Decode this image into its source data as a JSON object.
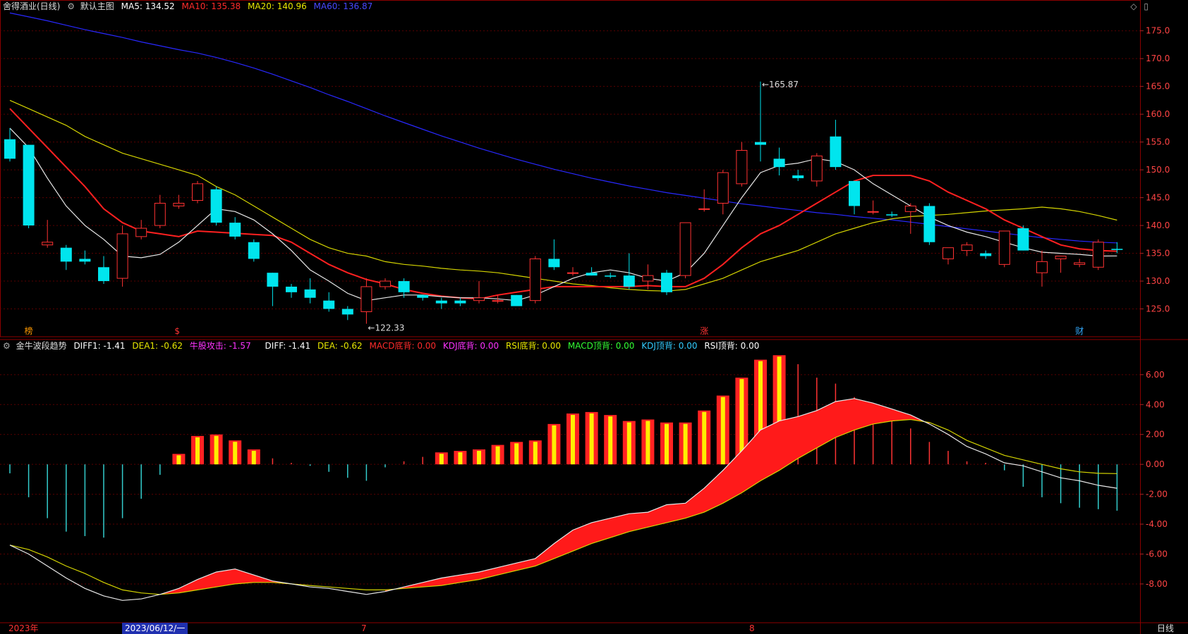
{
  "stock": {
    "title": "舍得酒业(日线)",
    "template": "默认主图",
    "ma_items": [
      {
        "label": "MA5: 134.52",
        "color": "#ffffff"
      },
      {
        "label": "MA10: 135.38",
        "color": "#ff2b2b"
      },
      {
        "label": "MA20: 140.96",
        "color": "#e8e800"
      },
      {
        "label": "MA60: 136.87",
        "color": "#2828ff"
      }
    ]
  },
  "indicator": {
    "name": "金牛波段趋势",
    "items": [
      {
        "label": "DIFF1: -1.41",
        "color": "#ffffff"
      },
      {
        "label": "DEA1: -0.62",
        "color": "#e8e800"
      },
      {
        "label": "牛股攻击: -1.57",
        "color": "#ff33ff"
      },
      {
        "label": "DIFF: -1.41",
        "color": "#ffffff"
      },
      {
        "label": "DEA: -0.62",
        "color": "#e8e800"
      },
      {
        "label": "MACD底背: 0.00",
        "color": "#ff2b2b"
      },
      {
        "label": "KDJ底背: 0.00",
        "color": "#ff33ff"
      },
      {
        "label": "RSI底背: 0.00",
        "color": "#e8e800"
      },
      {
        "label": "MACD顶背: 0.00",
        "color": "#33ff33"
      },
      {
        "label": "KDJ顶背: 0.00",
        "color": "#33ccff"
      },
      {
        "label": "RSI顶背: 0.00",
        "color": "#ffffff"
      }
    ]
  },
  "price_axis_labels": [
    "175.0",
    "170.0",
    "165.0",
    "160.0",
    "155.0",
    "150.0",
    "145.0",
    "140.0",
    "135.0",
    "130.0",
    "125.0"
  ],
  "macd_axis_labels": [
    "6.00",
    "4.00",
    "2.00",
    "0.00",
    "-2.00",
    "-4.00",
    "-6.00",
    "-8.00"
  ],
  "annotations": {
    "high": "165.87",
    "low": "122.33"
  },
  "markers": [
    "榜",
    "$",
    "涨",
    "财"
  ],
  "bottom": {
    "year": "2023年",
    "cursor_date": "2023/06/12/一",
    "jul": "7",
    "aug": "8",
    "period": "日线"
  },
  "icons": [
    "gear-icon",
    "diamond-icon",
    "window-icon"
  ],
  "chart_data": [
    {
      "type": "candlestick",
      "title": "舍得酒业(日线)",
      "ylim": [
        120,
        178
      ],
      "ohlc": [
        [
          155.5,
          157.5,
          151.5,
          152.0
        ],
        [
          154.5,
          154.5,
          139.5,
          140.0
        ],
        [
          136.5,
          141.0,
          136.0,
          137.0
        ],
        [
          136.0,
          136.5,
          132.0,
          133.5
        ],
        [
          134.0,
          135.5,
          133.0,
          133.5
        ],
        [
          132.5,
          134.5,
          129.5,
          130.0
        ],
        [
          130.5,
          140.0,
          129.0,
          138.5
        ],
        [
          138.0,
          141.0,
          137.5,
          139.5
        ],
        [
          140.0,
          145.5,
          139.5,
          144.0
        ],
        [
          143.5,
          145.5,
          143.0,
          144.0
        ],
        [
          144.5,
          148.0,
          144.0,
          147.5
        ],
        [
          146.5,
          147.0,
          140.0,
          140.5
        ],
        [
          140.5,
          141.5,
          137.5,
          138.0
        ],
        [
          137.0,
          137.5,
          133.5,
          134.0
        ],
        [
          131.5,
          131.5,
          125.5,
          129.0
        ],
        [
          129.0,
          129.5,
          127.0,
          128.0
        ],
        [
          128.5,
          130.5,
          126.0,
          127.0
        ],
        [
          126.5,
          128.0,
          124.5,
          125.0
        ],
        [
          125.0,
          125.5,
          123.0,
          124.0
        ],
        [
          124.5,
          130.5,
          122.33,
          129.0
        ],
        [
          129.0,
          130.5,
          128.5,
          130.0
        ],
        [
          130.0,
          130.5,
          127.0,
          128.0
        ],
        [
          127.5,
          127.5,
          126.5,
          127.0
        ],
        [
          126.5,
          127.0,
          125.0,
          126.0
        ],
        [
          126.5,
          127.0,
          125.5,
          126.0
        ],
        [
          126.5,
          130.0,
          126.0,
          127.0
        ],
        [
          126.5,
          127.5,
          126.0,
          126.5
        ],
        [
          127.5,
          127.5,
          126.0,
          125.5
        ],
        [
          126.5,
          134.5,
          126.0,
          134.0
        ],
        [
          134.0,
          137.5,
          132.0,
          132.5
        ],
        [
          131.5,
          132.5,
          131.0,
          131.5
        ],
        [
          131.5,
          132.5,
          131.0,
          131.0
        ],
        [
          131.0,
          131.5,
          130.5,
          130.8
        ],
        [
          131.0,
          135.0,
          128.5,
          129.0
        ],
        [
          130.0,
          133.0,
          128.5,
          131.0
        ],
        [
          131.5,
          132.0,
          127.5,
          128.0
        ],
        [
          131.0,
          140.5,
          130.5,
          140.5
        ],
        [
          143.0,
          146.5,
          142.5,
          143.0
        ],
        [
          144.0,
          150.0,
          142.0,
          149.5
        ],
        [
          147.5,
          155.0,
          147.0,
          153.5
        ],
        [
          155.0,
          165.87,
          151.5,
          154.5
        ],
        [
          152.0,
          154.0,
          149.0,
          150.5
        ],
        [
          149.0,
          150.0,
          148.0,
          148.5
        ],
        [
          148.0,
          153.0,
          147.0,
          152.5
        ],
        [
          156.0,
          159.0,
          150.0,
          150.5
        ],
        [
          148.0,
          148.0,
          142.0,
          143.5
        ],
        [
          142.5,
          144.5,
          142.0,
          142.5
        ],
        [
          142.0,
          142.5,
          141.5,
          141.8
        ],
        [
          142.5,
          144.0,
          138.5,
          143.5
        ],
        [
          143.5,
          144.0,
          136.5,
          137.0
        ],
        [
          134.0,
          136.0,
          133.0,
          136.0
        ],
        [
          135.5,
          137.0,
          134.5,
          136.5
        ],
        [
          135.0,
          135.5,
          134.0,
          134.5
        ],
        [
          133.0,
          139.0,
          132.5,
          139.0
        ],
        [
          139.5,
          140.0,
          135.5,
          135.5
        ],
        [
          131.5,
          135.5,
          129.0,
          133.5
        ],
        [
          134.0,
          134.5,
          131.5,
          134.5
        ],
        [
          133.0,
          134.0,
          132.5,
          133.3
        ],
        [
          132.5,
          137.5,
          132.0,
          137.0
        ],
        [
          135.8,
          137.0,
          135.0,
          135.6
        ]
      ],
      "ma5": [
        157.5,
        154.0,
        148.5,
        143.5,
        140.0,
        137.5,
        134.5,
        134.2,
        134.8,
        137.0,
        140.0,
        143.0,
        142.5,
        141.0,
        138.5,
        135.5,
        132.0,
        130.0,
        127.8,
        126.5,
        127.0,
        127.5,
        127.5,
        127.2,
        127.0,
        127.0,
        126.8,
        126.5,
        127.5,
        129.0,
        130.5,
        131.5,
        132.0,
        131.5,
        130.5,
        130.0,
        131.5,
        135.0,
        140.0,
        145.0,
        149.5,
        150.8,
        151.2,
        152.0,
        151.5,
        150.0,
        147.5,
        145.5,
        143.5,
        141.5,
        140.0,
        138.8,
        138.0,
        137.0,
        136.0,
        135.2,
        135.0,
        134.8,
        134.5,
        134.52
      ],
      "ma10": [
        161.0,
        157.5,
        154.0,
        150.5,
        147.0,
        143.0,
        140.5,
        139.0,
        138.5,
        138.0,
        139.0,
        138.8,
        138.6,
        138.4,
        138.2,
        137.0,
        135.0,
        133.0,
        131.5,
        130.3,
        129.5,
        128.5,
        127.8,
        127.3,
        127.0,
        126.8,
        127.5,
        128.0,
        128.5,
        129.0,
        129.0,
        129.0,
        129.0,
        129.0,
        129.2,
        129.0,
        129.0,
        130.5,
        133.0,
        136.0,
        138.5,
        140.0,
        142.0,
        144.0,
        146.0,
        148.0,
        149.0,
        149.0,
        149.0,
        148.0,
        146.0,
        144.5,
        143.0,
        141.0,
        139.5,
        138.0,
        136.5,
        135.8,
        135.5,
        135.38
      ],
      "ma20": [
        162.5,
        161.0,
        159.5,
        158.0,
        156.0,
        154.5,
        153.0,
        152.0,
        151.0,
        150.0,
        149.0,
        147.0,
        145.5,
        143.5,
        141.5,
        139.5,
        137.5,
        136.0,
        135.0,
        134.5,
        133.5,
        133.0,
        132.7,
        132.3,
        132.0,
        131.8,
        131.5,
        131.0,
        130.5,
        130.0,
        129.5,
        129.2,
        128.8,
        128.5,
        128.3,
        128.2,
        128.5,
        129.5,
        130.5,
        132.0,
        133.5,
        134.5,
        135.5,
        137.0,
        138.5,
        139.5,
        140.5,
        141.2,
        141.6,
        141.8,
        142.0,
        142.3,
        142.6,
        142.8,
        143.0,
        143.3,
        143.0,
        142.5,
        141.8,
        140.96
      ],
      "ma60": [
        178.2,
        177.5,
        176.8,
        176.0,
        175.2,
        174.5,
        173.8,
        173.0,
        172.3,
        171.6,
        171.0,
        170.2,
        169.3,
        168.3,
        167.2,
        166.0,
        164.8,
        163.5,
        162.3,
        161.0,
        159.7,
        158.5,
        157.3,
        156.1,
        155.0,
        153.9,
        152.9,
        151.9,
        151.0,
        150.1,
        149.3,
        148.5,
        147.8,
        147.1,
        146.5,
        145.9,
        145.4,
        144.9,
        144.4,
        143.9,
        143.5,
        143.1,
        142.7,
        142.3,
        142.0,
        141.6,
        141.3,
        141.0,
        140.6,
        140.2,
        139.8,
        139.4,
        139.0,
        138.6,
        138.2,
        137.8,
        137.5,
        137.2,
        137.0,
        136.87
      ]
    },
    {
      "type": "bar",
      "title": "金牛波段趋势",
      "ylim": [
        -10.5,
        7.5
      ],
      "hist": [
        -0.6,
        -2.2,
        -3.6,
        -4.5,
        -4.8,
        -4.9,
        -3.6,
        -2.3,
        -0.7,
        0.7,
        1.9,
        2.0,
        1.6,
        1.0,
        0.4,
        0.1,
        -0.1,
        -0.5,
        -0.9,
        -1.1,
        -0.2,
        0.2,
        0.5,
        0.8,
        0.9,
        1.0,
        1.3,
        1.5,
        1.6,
        2.7,
        3.4,
        3.5,
        3.3,
        2.9,
        3.0,
        2.8,
        2.8,
        3.6,
        4.6,
        5.8,
        7.0,
        7.3,
        6.7,
        5.8,
        5.4,
        4.5,
        3.9,
        3.0,
        2.4,
        1.5,
        0.9,
        0.2,
        0.1,
        -0.4,
        -1.5,
        -2.2,
        -2.6,
        -2.9,
        -3.0,
        -3.1
      ],
      "diff": [
        -5.4,
        -6.0,
        -6.8,
        -7.6,
        -8.3,
        -8.8,
        -9.1,
        -9.0,
        -8.7,
        -8.3,
        -7.7,
        -7.2,
        -7.0,
        -7.4,
        -7.8,
        -8.0,
        -8.2,
        -8.3,
        -8.5,
        -8.7,
        -8.5,
        -8.2,
        -7.9,
        -7.6,
        -7.4,
        -7.2,
        -6.9,
        -6.6,
        -6.3,
        -5.3,
        -4.4,
        -3.9,
        -3.6,
        -3.3,
        -3.2,
        -2.7,
        -2.6,
        -1.6,
        -0.4,
        0.9,
        2.3,
        2.9,
        3.2,
        3.6,
        4.2,
        4.4,
        4.1,
        3.7,
        3.3,
        2.7,
        2.0,
        1.2,
        0.7,
        0.1,
        -0.1,
        -0.5,
        -0.9,
        -1.1,
        -1.4,
        -1.6
      ],
      "dea": [
        -5.4,
        -5.7,
        -6.2,
        -6.8,
        -7.3,
        -7.9,
        -8.4,
        -8.6,
        -8.7,
        -8.6,
        -8.4,
        -8.2,
        -8.0,
        -7.9,
        -7.9,
        -8.0,
        -8.1,
        -8.2,
        -8.3,
        -8.4,
        -8.4,
        -8.3,
        -8.2,
        -8.1,
        -7.9,
        -7.7,
        -7.4,
        -7.1,
        -6.8,
        -6.3,
        -5.8,
        -5.3,
        -4.9,
        -4.5,
        -4.2,
        -3.9,
        -3.6,
        -3.2,
        -2.6,
        -1.9,
        -1.1,
        -0.4,
        0.4,
        1.1,
        1.8,
        2.3,
        2.7,
        2.9,
        3.0,
        2.8,
        2.3,
        1.6,
        1.1,
        0.6,
        0.3,
        0.0,
        -0.3,
        -0.5,
        -0.6,
        -0.62
      ]
    }
  ]
}
